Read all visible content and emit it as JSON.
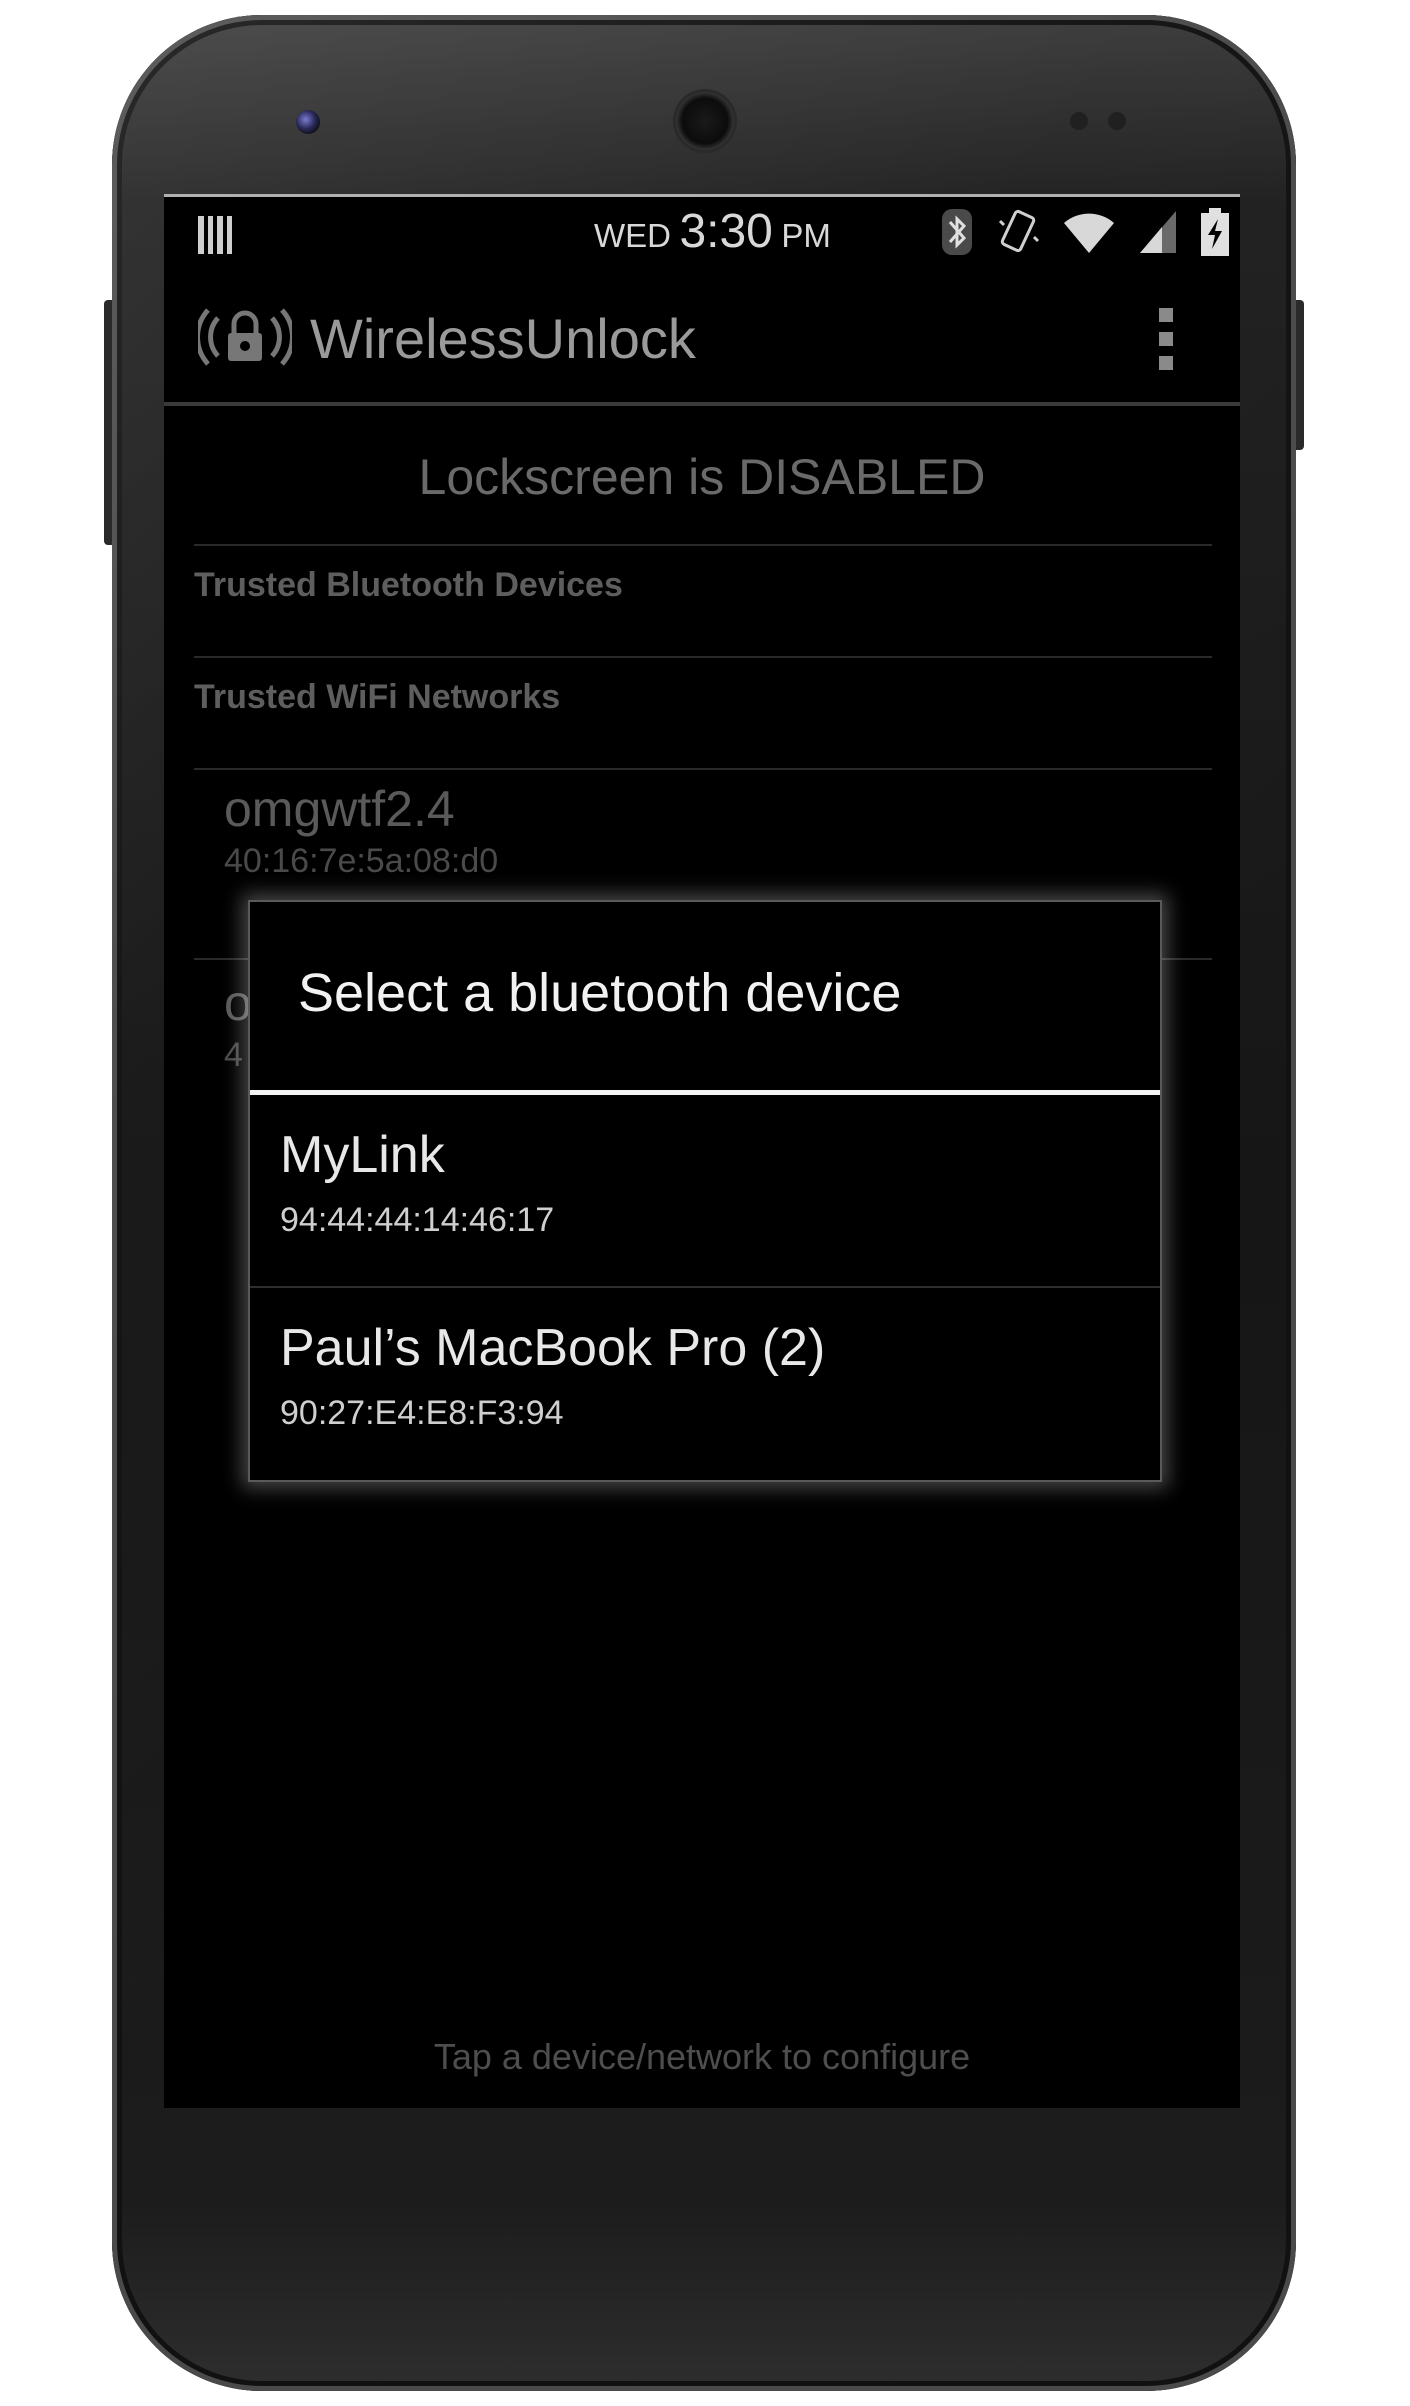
{
  "status_bar": {
    "day": "WED",
    "time": "3:30",
    "ampm": "PM",
    "icons": [
      "notification-icon",
      "bluetooth-icon",
      "vibrate-icon",
      "wifi-icon",
      "signal-icon",
      "battery-charging-icon"
    ]
  },
  "action_bar": {
    "app_title": "WirelessUnlock",
    "app_icon": "wireless-lock-icon",
    "menu_icon": "overflow-menu-icon"
  },
  "main": {
    "lock_status": "Lockscreen is DISABLED",
    "sections": {
      "bluetooth_header": "Trusted Bluetooth Devices",
      "wifi_header": "Trusted WiFi Networks"
    },
    "wifi_networks": [
      {
        "name": "omgwtf2.4",
        "mac": "40:16:7e:5a:08:d0"
      },
      {
        "name": "o",
        "mac": "4"
      }
    ],
    "footer_hint": "Tap a device/network to configure"
  },
  "dialog": {
    "title": "Select a bluetooth device",
    "devices": [
      {
        "name": "MyLink",
        "mac": "94:44:44:14:46:17"
      },
      {
        "name": "Paul’s MacBook Pro (2)",
        "mac": "90:27:E4:E8:F3:94"
      }
    ]
  },
  "colors": {
    "screen_background": "#000000",
    "phone_body": "#1a1a1a",
    "dialog_title_rule": "#f4f4f4"
  }
}
